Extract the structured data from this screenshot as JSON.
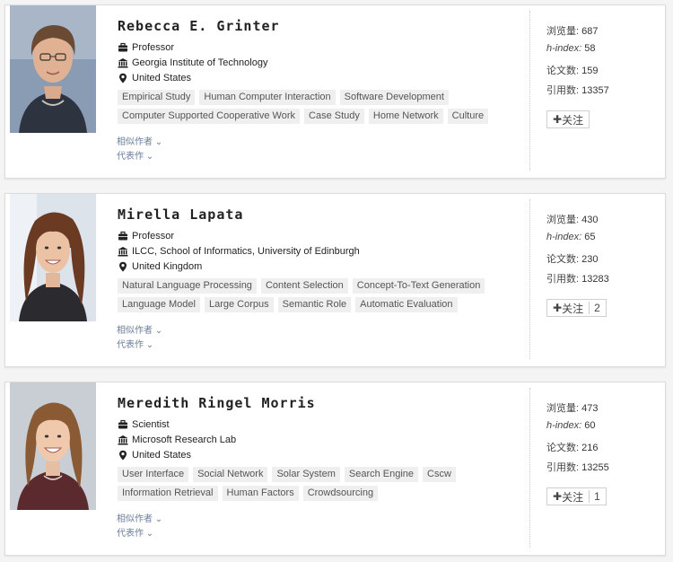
{
  "scholars": [
    {
      "name": "Rebecca E. Grinter",
      "title": "Professor",
      "org": "Georgia Institute of Technology",
      "location": "United States",
      "tags_row1": [
        "Empirical Study",
        "Human Computer Interaction",
        "Software Development"
      ],
      "tags_row2": [
        "Computer Supported Cooperative Work",
        "Case Study",
        "Home Network",
        "Culture"
      ],
      "similar_label": "相似作者",
      "works_label": "代表作",
      "views_label": "浏览量:",
      "views": "687",
      "hindex_label": "h-index:",
      "hindex": "58",
      "papers_label": "论文数:",
      "papers": "159",
      "citations_label": "引用数:",
      "citations": "13357",
      "follow_label": "关注",
      "follow_count": ""
    },
    {
      "name": "Mirella Lapata",
      "title": "Professor",
      "org": "ILCC, School of Informatics, University of Edinburgh",
      "location": "United Kingdom",
      "tags_row1": [
        "Natural Language Processing",
        "Content Selection",
        "Concept-To-Text Generation"
      ],
      "tags_row2": [
        "Language Model",
        "Large Corpus",
        "Semantic Role",
        "Automatic Evaluation"
      ],
      "similar_label": "相似作者",
      "works_label": "代表作",
      "views_label": "浏览量:",
      "views": "430",
      "hindex_label": "h-index:",
      "hindex": "65",
      "papers_label": "论文数:",
      "papers": "230",
      "citations_label": "引用数:",
      "citations": "13283",
      "follow_label": "关注",
      "follow_count": "2"
    },
    {
      "name": "Meredith Ringel Morris",
      "title": "Scientist",
      "org": "Microsoft Research Lab",
      "location": "United States",
      "tags_row1": [
        "User Interface",
        "Social Network",
        "Solar System",
        "Search Engine",
        "Cscw"
      ],
      "tags_row2": [
        "Information Retrieval",
        "Human Factors",
        "Crowdsourcing"
      ],
      "similar_label": "相似作者",
      "works_label": "代表作",
      "views_label": "浏览量:",
      "views": "473",
      "hindex_label": "h-index:",
      "hindex": "60",
      "papers_label": "论文数:",
      "papers": "216",
      "citations_label": "引用数:",
      "citations": "13255",
      "follow_label": "关注",
      "follow_count": "1"
    }
  ],
  "colors": {
    "link": "#6a7d99",
    "tag_bg": "#efefef"
  },
  "icons": [
    "briefcase-icon",
    "institution-icon",
    "location-pin-icon",
    "plus-icon",
    "chevron-down-icon"
  ]
}
